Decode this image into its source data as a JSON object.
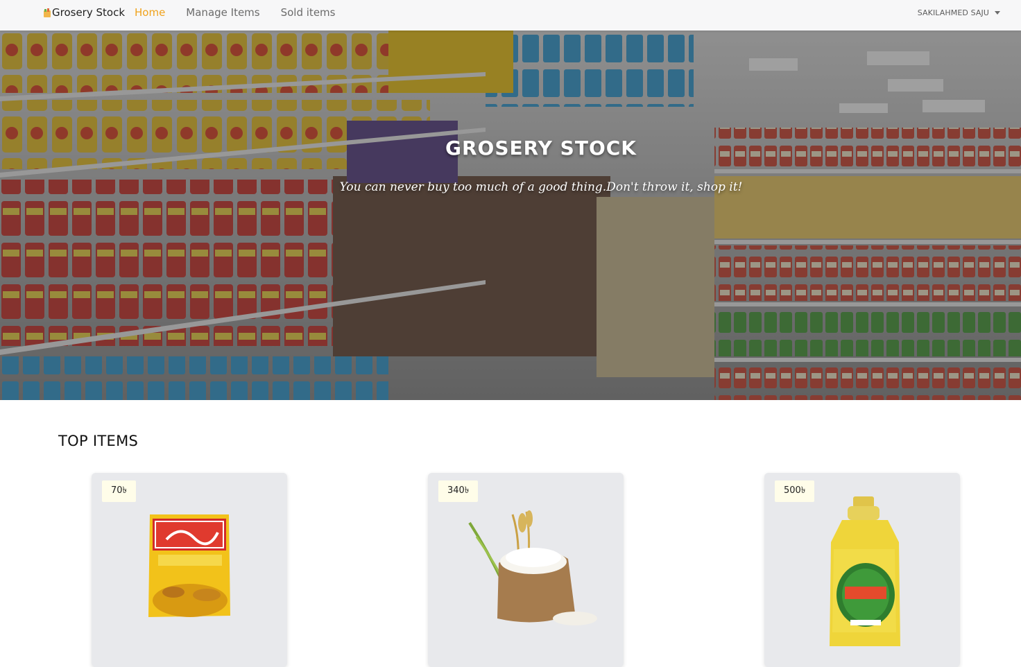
{
  "navbar": {
    "brand": "Grosery Stock",
    "brand_icon": "grocery-bag-icon",
    "links": [
      {
        "label": "Home",
        "active": true
      },
      {
        "label": "Manage Items",
        "active": false
      },
      {
        "label": "Sold items",
        "active": false
      }
    ],
    "user": "SAKILAHMED SAJU",
    "user_icon": "caret-down-icon"
  },
  "hero": {
    "title": "GROSERY STOCK",
    "subtitle": "You can never buy too much of a good thing.Don't throw it, shop it!"
  },
  "top_items": {
    "heading": "TOP ITEMS",
    "items": [
      {
        "price": "70৳",
        "image": "turmeric-powder-packet"
      },
      {
        "price": "340৳",
        "image": "rice-sack"
      },
      {
        "price": "500৳",
        "image": "soybean-oil-bottle"
      }
    ]
  },
  "colors": {
    "accent": "#f0a21b",
    "nav_bg": "#f7f7f8",
    "card_bg": "#e8e9ec",
    "badge_bg": "#fffde9"
  }
}
